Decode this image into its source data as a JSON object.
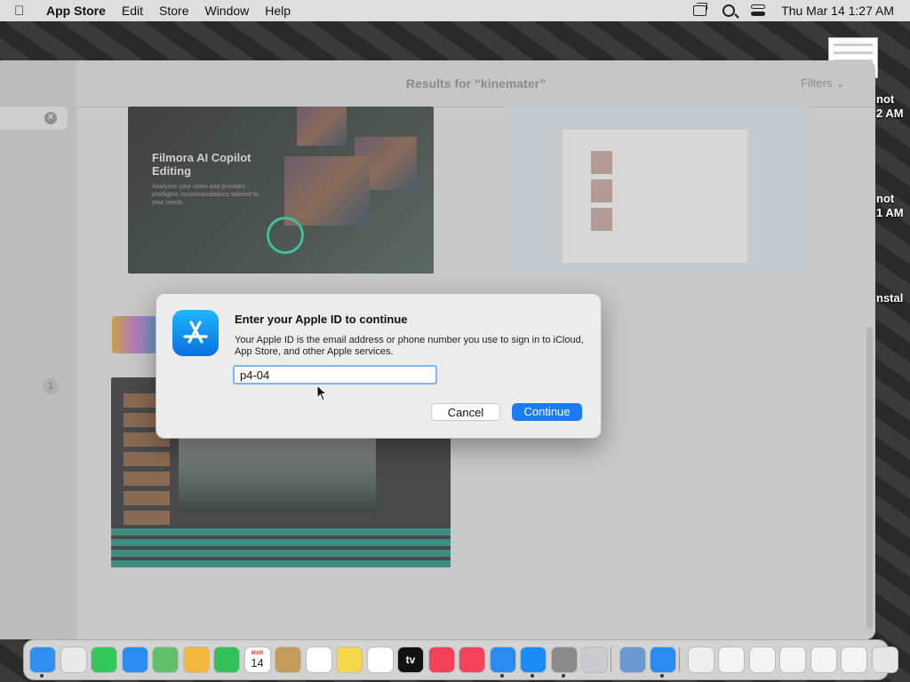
{
  "menubar": {
    "app_name": "App Store",
    "menus": [
      "Edit",
      "Store",
      "Window",
      "Help"
    ],
    "clock": "Thu Mar 14  1:27 AM"
  },
  "desktop": {
    "labels": [
      "not",
      "2 AM",
      "not",
      "1 AM",
      "nstal"
    ]
  },
  "window": {
    "results_title": "Results for “kinemater”",
    "filters_label": "Filters",
    "sidebar_badge": "1",
    "card_filmora": {
      "title": "Filmora AI Copilot Editing",
      "description": "Analyzes your video and provides intelligent recommendations tailored to your needs."
    }
  },
  "dialog": {
    "title": "Enter your Apple ID to continue",
    "message": "Your Apple ID is the email address or phone number you use to sign in to iCloud, App Store, and other Apple services.",
    "input_value": "p4-04",
    "cancel_label": "Cancel",
    "continue_label": "Continue"
  },
  "dock": {
    "calendar_month": "MAR",
    "calendar_day": "14",
    "appletv_label": "tv",
    "apps": [
      {
        "name": "finder-icon",
        "color": "#2f8ff0"
      },
      {
        "name": "launchpad-icon",
        "color": "#e9e9e9"
      },
      {
        "name": "messages-icon",
        "color": "#33c75a"
      },
      {
        "name": "mail-icon",
        "color": "#2a8cf3"
      },
      {
        "name": "maps-icon",
        "color": "#5fbf6a"
      },
      {
        "name": "photos-icon",
        "color": "#f4b63b"
      },
      {
        "name": "facetime-icon",
        "color": "#32c05a"
      },
      {
        "name": "calendar-icon",
        "color": "#ffffff"
      },
      {
        "name": "contacts-icon",
        "color": "#c49a5a"
      },
      {
        "name": "reminders-icon",
        "color": "#ffffff"
      },
      {
        "name": "notes-icon",
        "color": "#f6d64a"
      },
      {
        "name": "freeform-icon",
        "color": "#ffffff"
      },
      {
        "name": "appletv-icon",
        "color": "#111111"
      },
      {
        "name": "music-icon",
        "color": "#f6405a"
      },
      {
        "name": "news-icon",
        "color": "#f4425a"
      },
      {
        "name": "keynote-icon",
        "color": "#2a8cf3"
      },
      {
        "name": "appstore-icon",
        "color": "#1b8cf5"
      },
      {
        "name": "system-settings-icon",
        "color": "#8a8a8a"
      },
      {
        "name": "app-placeholder-icon",
        "color": "#c8ccd0"
      },
      {
        "name": "preview-icon",
        "color": "#6a9ad0"
      },
      {
        "name": "safari-icon",
        "color": "#2a8cf3"
      },
      {
        "name": "document-icon",
        "color": "#eeeeee"
      },
      {
        "name": "window-thumbnail-icon",
        "color": "#f4f4f4"
      },
      {
        "name": "window-thumbnail-icon",
        "color": "#f4f4f4"
      },
      {
        "name": "window-thumbnail-icon",
        "color": "#f4f4f4"
      },
      {
        "name": "window-thumbnail-icon",
        "color": "#f4f4f4"
      },
      {
        "name": "window-thumbnail-icon",
        "color": "#f4f4f4"
      },
      {
        "name": "trash-icon",
        "color": "#e6e6e6"
      }
    ]
  },
  "colors": {
    "accent": "#1b7df5",
    "focus_ring": "#7fb3f5"
  }
}
